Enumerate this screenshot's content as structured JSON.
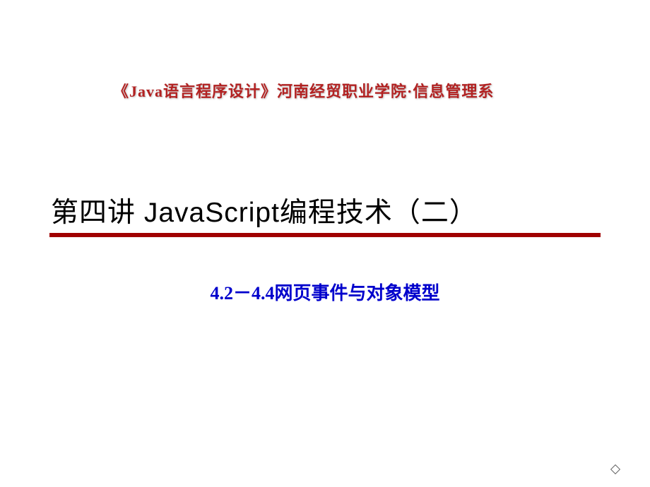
{
  "header": {
    "course_info": "《Java语言程序设计》河南经贸职业学院·信息管理系"
  },
  "main": {
    "title": "第四讲 JavaScript编程技术（二）",
    "subtitle": "4.2－4.4网页事件与对象模型"
  }
}
